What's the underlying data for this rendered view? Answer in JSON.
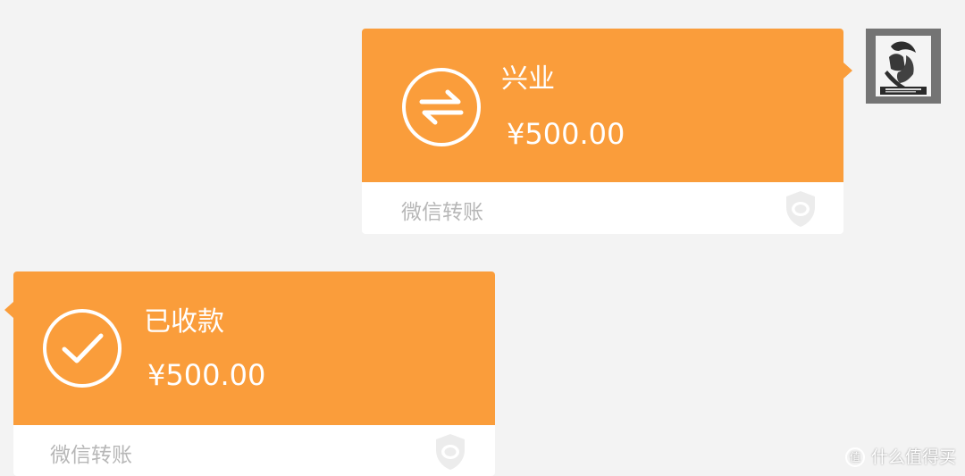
{
  "messages": [
    {
      "title": "兴业",
      "amount": "¥500.00",
      "footer": "微信转账",
      "icon": "transfer-arrows-icon"
    },
    {
      "title": "已收款",
      "amount": "¥500.00",
      "footer": "微信转账",
      "icon": "checkmark-icon"
    }
  ],
  "watermark": {
    "text": "什么值得买"
  },
  "colors": {
    "bubble_orange": "#fa9d3b",
    "background": "#f3f3f3",
    "footer_text": "#b7b7b7"
  }
}
